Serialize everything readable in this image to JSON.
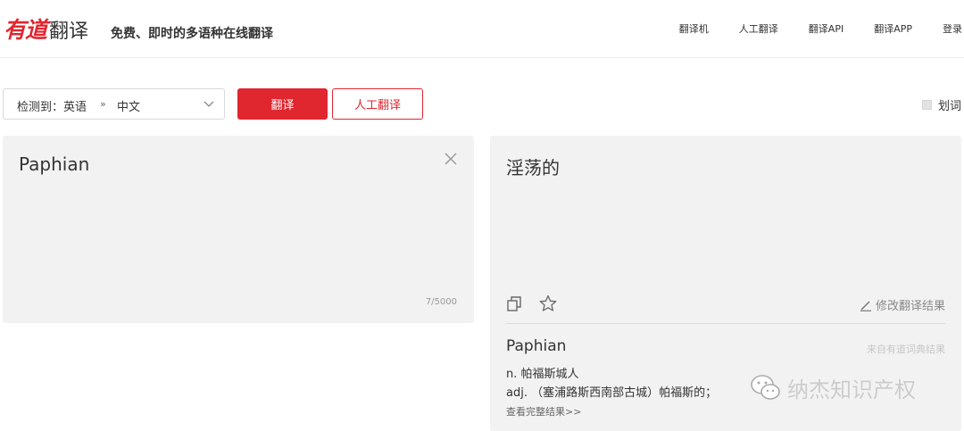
{
  "header": {
    "logo_brand": "有道",
    "logo_product": "翻译",
    "slogan": "免费、即时的多语种在线翻译",
    "nav": [
      "翻译机",
      "人工翻译",
      "翻译API",
      "翻译APP",
      "登录"
    ]
  },
  "toolbar": {
    "source_lang": "检测到：英语",
    "arrows": "»",
    "target_lang": "中文",
    "translate_label": "翻译",
    "human_label": "人工翻译",
    "word_select_label": "划词"
  },
  "source": {
    "text": "Paphian",
    "char_count": "7/5000"
  },
  "result": {
    "text": "淫荡的",
    "edit_label": "修改翻译结果",
    "dict_word": "Paphian",
    "dict_source": "来自有道词典结果",
    "definition_1": "n. 帕福斯城人",
    "definition_2": "adj. （塞浦路斯西南部古城）帕福斯的；",
    "more_label": "查看完整结果>>"
  },
  "watermark": {
    "text": "纳杰知识产权"
  },
  "colors": {
    "accent": "#e0262f",
    "panel_bg": "#f2f2f2"
  },
  "icons": [
    "chevron-down-icon",
    "close-icon",
    "copy-icon",
    "star-icon",
    "pencil-icon",
    "wechat-icon"
  ]
}
